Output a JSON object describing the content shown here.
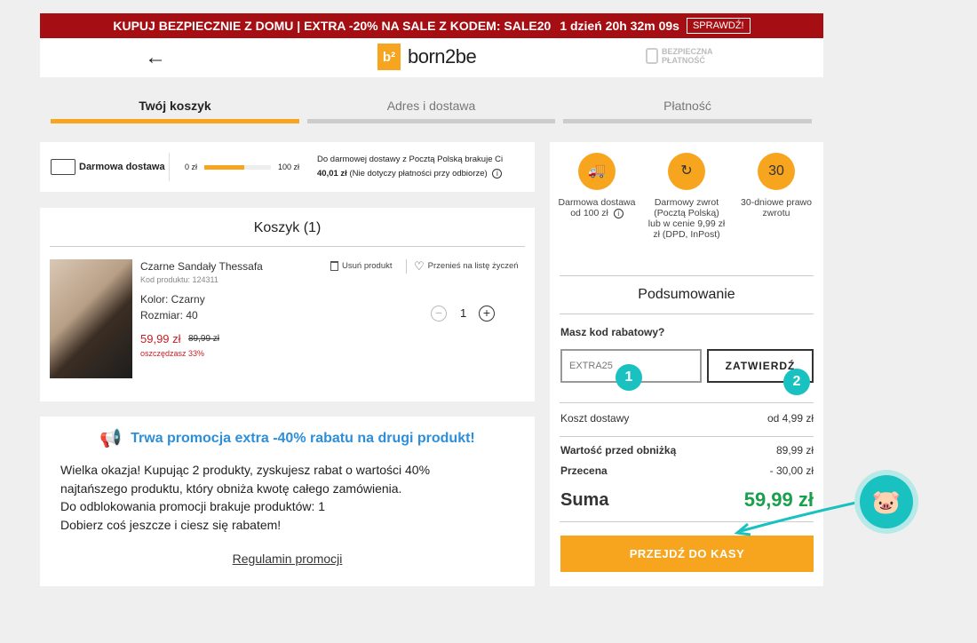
{
  "promo_bar": {
    "text": "KUPUJ BEZPIECZNIE Z DOMU | EXTRA -20% NA SALE Z KODEM: SALE20",
    "countdown": "1 dzień 20h 32m 09s",
    "button": "SPRAWDŹ!"
  },
  "header": {
    "back_icon": "←",
    "logo_mark": "b²",
    "logo_text": "born2be",
    "secure_line1": "BEZPIECZNA",
    "secure_line2": "PŁATNOŚĆ"
  },
  "steps": [
    {
      "label": "Twój koszyk",
      "active": true
    },
    {
      "label": "Adres i dostawa",
      "active": false
    },
    {
      "label": "Płatność",
      "active": false
    }
  ],
  "delivery": {
    "label": "Darmowa dostawa",
    "min": "0 zł",
    "max": "100 zł",
    "progress": 0.6,
    "msg_line1": "Do darmowej dostawy z Pocztą Polską brakuje Ci",
    "amount": "40,01 zł",
    "msg_note": "(Nie dotyczy płatności przy odbiorze)"
  },
  "cart": {
    "title": "Koszyk (1)",
    "item": {
      "name": "Czarne Sandały Thessafa",
      "code": "Kod produktu: 124311",
      "color": "Kolor: Czarny",
      "size": "Rozmiar: 40",
      "price": "59,99 zł",
      "old_price": "89,99 zł",
      "saving": "oszczędzasz 33%",
      "remove": "Usuń produkt",
      "wishlist": "Przenieś na listę życzeń",
      "qty": "1",
      "minus": "−",
      "plus": "+"
    }
  },
  "promo": {
    "title": "Trwa promocja extra -40% rabatu na drugi produkt!",
    "line1": "Wielka okazja! Kupując 2 produkty, zyskujesz rabat o wartości 40%",
    "line2": "najtańszego produktu, który obniża kwotę całego zamówienia.",
    "line3": "Do odblokowania promocji brakuje produktów: 1",
    "line4": "Dobierz coś jeszcze i ciesz się rabatem!",
    "rules": "Regulamin promocji"
  },
  "benefits": [
    {
      "icon": "truck-icon",
      "text": "Darmowa dostawa od 100 zł"
    },
    {
      "icon": "return-icon",
      "text": "Darmowy zwrot (Pocztą Polską) lub w cenie 9,99 zł zł (DPD, InPost)"
    },
    {
      "icon": "calendar-icon",
      "text": "30-dniowe prawo zwrotu",
      "glyph": "30"
    }
  ],
  "summary": {
    "title": "Podsumowanie",
    "coupon_label": "Masz kod rabatowy?",
    "coupon_value": "EXTRA25",
    "coupon_button": "ZATWIERDŹ",
    "badge1": "1",
    "badge2": "2",
    "shipping_label": "Koszt dostawy",
    "shipping_value": "od 4,99 zł",
    "before_label": "Wartość przed obniżką",
    "before_value": "89,99 zł",
    "discount_label": "Przecena",
    "discount_value": "- 30,00 zł",
    "sum_label": "Suma",
    "sum_value": "59,99 zł",
    "checkout": "PRZEJDŹ DO KASY"
  },
  "colors": {
    "accent": "#f7a51f",
    "promo_bar": "#a50f13",
    "price_red": "#c71c22",
    "sum_green": "#1aa04c",
    "teal": "#19c2c0",
    "promo_blue": "#2d8ed9"
  }
}
